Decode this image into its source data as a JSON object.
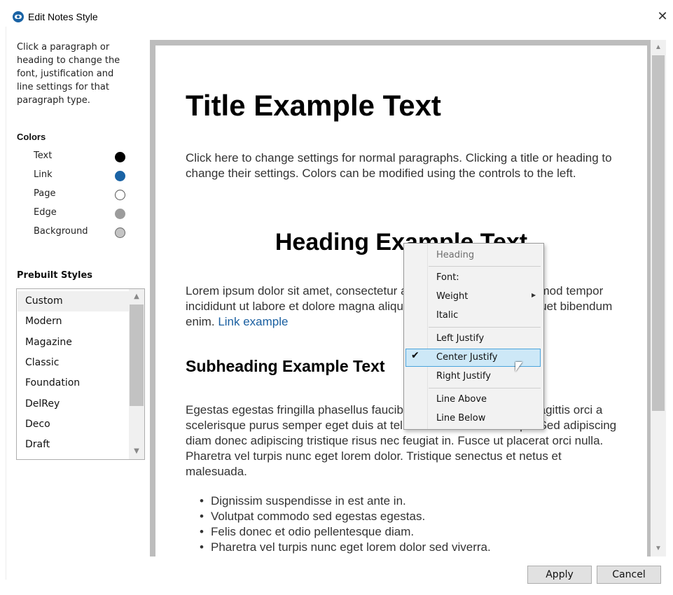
{
  "window": {
    "title": "Edit Notes Style",
    "close_symbol": "✕"
  },
  "sidebar": {
    "help_text": "Click a paragraph or heading to change the font, justification and line settings for that paragraph type.",
    "colors_heading": "Colors",
    "colors": [
      {
        "label": "Text",
        "color": "#000000"
      },
      {
        "label": "Link",
        "color": "#1a63a5"
      },
      {
        "label": "Page",
        "color": "#ffffff"
      },
      {
        "label": "Edge",
        "color": "#9c9c9c"
      },
      {
        "label": "Background",
        "color": "#c4c4c4"
      }
    ],
    "prebuilt_heading": "Prebuilt Styles",
    "styles": [
      "Custom",
      "Modern",
      "Magazine",
      "Classic",
      "Foundation",
      "DelRey",
      "Deco",
      "Draft"
    ],
    "selected_style": "Custom"
  },
  "preview": {
    "title": "Title Example Text",
    "intro_paragraph": "Click here to change settings for normal paragraphs. Clicking a title or heading to change their settings. Colors can be modified using the controls to the left.",
    "heading": "Heading Example Text",
    "lorem_paragraph": "Lorem ipsum dolor sit amet, consectetur adipiscing elit, sed do eiusmod tempor incididunt ut labore et dolore magna aliqua. Viverra ipsum nunc aliquet bibendum enim.",
    "link_text": "Link example",
    "subheading": "Subheading Example Text",
    "body_paragraph": "Egestas egestas fringilla phasellus faucibus scelerisque eleifend. Sagittis orci a scelerisque purus semper eget duis at tellus. Sit amet nisl suscipit. Sed adipiscing diam donec adipiscing tristique risus nec feugiat in. Fusce ut placerat orci nulla. Pharetra vel turpis nunc eget lorem dolor. Tristique senectus et netus et malesuada.",
    "bullets": [
      "Dignissim suspendisse in est ante in.",
      "Volutpat commodo sed egestas egestas.",
      "Felis donec et odio pellentesque diam.",
      "Pharetra vel turpis nunc eget lorem dolor sed viverra."
    ]
  },
  "context_menu": {
    "header": "Heading",
    "font": "Font:",
    "weight": "Weight",
    "italic": "Italic",
    "left_justify": "Left Justify",
    "center_justify": "Center Justify",
    "right_justify": "Right Justify",
    "line_above": "Line Above",
    "line_below": "Line Below",
    "checked_item": "Center Justify"
  },
  "buttons": {
    "apply": "Apply",
    "cancel": "Cancel"
  }
}
